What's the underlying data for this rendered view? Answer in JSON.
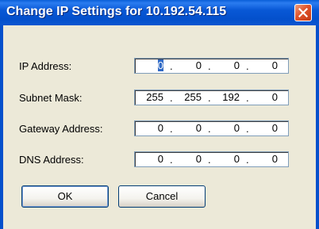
{
  "window": {
    "title": "Change IP Settings for 10.192.54.115",
    "close_icon": "close-icon"
  },
  "rows": [
    {
      "label": "IP Address:",
      "octets": [
        "0",
        "0",
        "0",
        "0"
      ]
    },
    {
      "label": "Subnet Mask:",
      "octets": [
        "255",
        "255",
        "192",
        "0"
      ]
    },
    {
      "label": "Gateway Address:",
      "octets": [
        "0",
        "0",
        "0",
        "0"
      ]
    },
    {
      "label": "DNS Address:",
      "octets": [
        "0",
        "0",
        "0",
        "0"
      ]
    }
  ],
  "separator": ".",
  "buttons": {
    "ok": "OK",
    "cancel": "Cancel"
  }
}
